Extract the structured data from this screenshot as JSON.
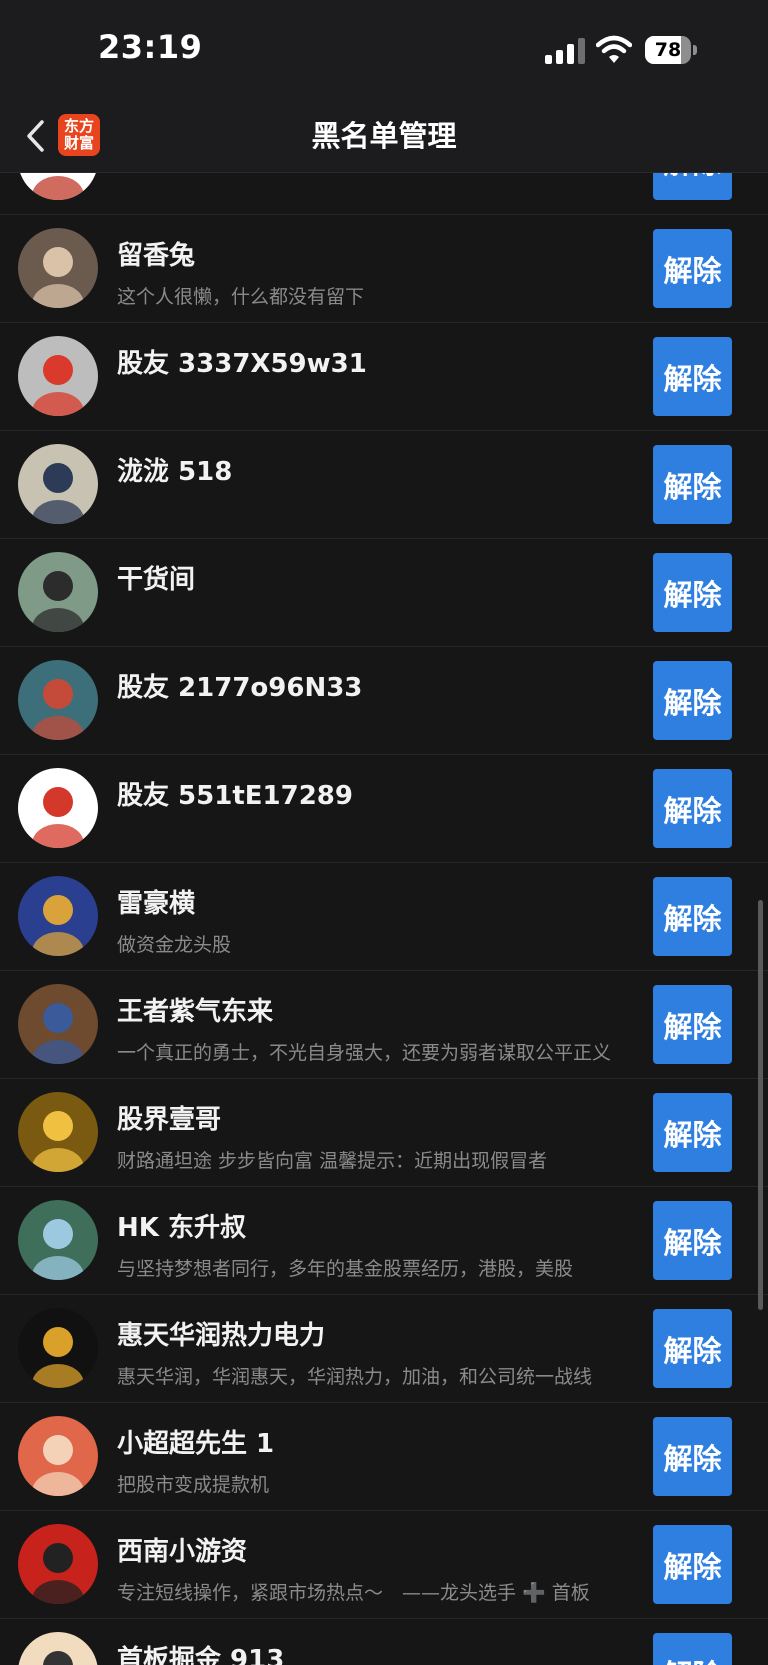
{
  "status_bar": {
    "time": "23:19",
    "battery_level": "78",
    "battery_fraction": 0.78
  },
  "nav": {
    "back_icon": "chevron-left-icon",
    "logo_line1": "东方",
    "logo_line2": "财富",
    "title": "黑名单管理"
  },
  "action_label": "解除",
  "users": [
    {
      "name": "",
      "bio": "",
      "avatar": {
        "bg": "#ffffff",
        "accent": "#c0392b"
      }
    },
    {
      "name": "留香兔",
      "bio": "这个人很懒，什么都没有留下",
      "avatar": {
        "bg": "#6b5a4e",
        "accent": "#d9c2a8"
      }
    },
    {
      "name": "股友 3337X59w31",
      "bio": "",
      "avatar": {
        "bg": "#bdbdbd",
        "accent": "#d93a2b"
      }
    },
    {
      "name": "泷泷 518",
      "bio": "",
      "avatar": {
        "bg": "#c8c2b2",
        "accent": "#2d3b57"
      }
    },
    {
      "name": "干货间",
      "bio": "",
      "avatar": {
        "bg": "#7f9a86",
        "accent": "#2c2c2c"
      }
    },
    {
      "name": "股友 2177o96N33",
      "bio": "",
      "avatar": {
        "bg": "#3d6f7a",
        "accent": "#c44a3a"
      }
    },
    {
      "name": "股友 551tE17289",
      "bio": "",
      "avatar": {
        "bg": "#ffffff",
        "accent": "#d4382b"
      }
    },
    {
      "name": "雷豪横",
      "bio": "做资金龙头股",
      "avatar": {
        "bg": "#2a3f8f",
        "accent": "#d9a23a"
      }
    },
    {
      "name": "王者紫气东来",
      "bio": "一个真正的勇士，不光自身强大，还要为弱者谋取公平正义",
      "avatar": {
        "bg": "#6e4a2e",
        "accent": "#3a5a9a"
      }
    },
    {
      "name": "股界壹哥",
      "bio": "财路通坦途 步步皆向富 温馨提示：近期出现假冒者",
      "avatar": {
        "bg": "#7a5a10",
        "accent": "#f0c040"
      }
    },
    {
      "name": "HK 东升叔",
      "bio": "与坚持梦想者同行，多年的基金股票经历，港股，美股",
      "avatar": {
        "bg": "#3f6e5a",
        "accent": "#9cc9e0"
      }
    },
    {
      "name": "惠天华润热力电力",
      "bio": "惠天华润，华润惠天，华润热力，加油，和公司统一战线",
      "avatar": {
        "bg": "#111111",
        "accent": "#d9a02a"
      }
    },
    {
      "name": "小超超先生 1",
      "bio": "把股市变成提款机",
      "avatar": {
        "bg": "#e0674a",
        "accent": "#f3d2b8"
      }
    },
    {
      "name": "西南小游资",
      "bio": "专注短线操作，紧跟市场热点～　——龙头选手 ➕ 首板",
      "avatar": {
        "bg": "#c8221c",
        "accent": "#222222"
      }
    },
    {
      "name": "首板掘金 913",
      "bio": "",
      "avatar": {
        "bg": "#f2dcc0",
        "accent": "#333333"
      }
    }
  ]
}
